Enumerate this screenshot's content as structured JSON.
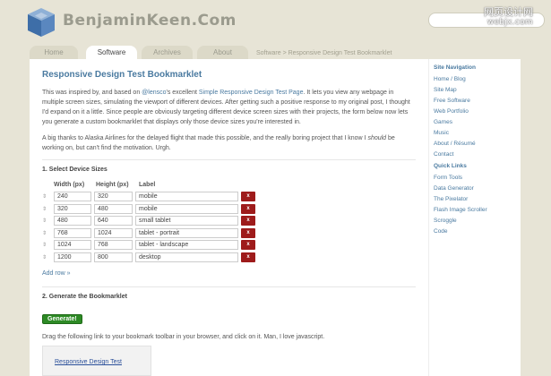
{
  "site": {
    "name": "BenjaminKeen.Com"
  },
  "watermark": {
    "line1": "网页设计网",
    "line2": "webjx.com"
  },
  "search": {
    "placeholder": ""
  },
  "nav": {
    "tabs": [
      {
        "label": "Home"
      },
      {
        "label": "Software",
        "active": true
      },
      {
        "label": "Archives"
      },
      {
        "label": "About"
      }
    ],
    "breadcrumb": "Software > Responsive Design Test Bookmarklet"
  },
  "main": {
    "title": "Responsive Design Test Bookmarklet",
    "intro": {
      "p1_a": "This was inspired by, and based on ",
      "p1_link1": "@lensco",
      "p1_b": "'s excellent ",
      "p1_link2": "Simple Responsive Design Test Page",
      "p1_c": ". It lets you view any webpage in multiple screen sizes, simulating the viewport of different devices. After getting such a positive response to my original post, I thought I'd expand on it a little. Since people are obviously targeting different device screen sizes with their projects, the form below now lets you generate a custom bookmarklet that displays only those device sizes you're interested in.",
      "p2_a": "A big thanks to Alaska Airlines for the delayed flight that made this possible, and the really boring project that I know I ",
      "p2_em": "should",
      "p2_b": " be working on, but can't find the motivation. Urgh."
    },
    "section1": {
      "title": "1. Select Device Sizes",
      "columns": [
        "Width (px)",
        "Height (px)",
        "Label"
      ],
      "rows": [
        {
          "width": "240",
          "height": "320",
          "label": "mobile"
        },
        {
          "width": "320",
          "height": "480",
          "label": "mobile"
        },
        {
          "width": "480",
          "height": "640",
          "label": "small tablet"
        },
        {
          "width": "768",
          "height": "1024",
          "label": "tablet - portrait"
        },
        {
          "width": "1024",
          "height": "768",
          "label": "tablet - landscape"
        },
        {
          "width": "1200",
          "height": "800",
          "label": "desktop"
        }
      ],
      "delete_label": "x",
      "add_row": "Add row »"
    },
    "section2": {
      "title": "2. Generate the Bookmarklet",
      "button": "Generate!",
      "instructions": "Drag the following link to your bookmark toolbar in your browser, and click on it. Man, I love javascript.",
      "bookmark_link": "Responsive Design Test"
    }
  },
  "sidebar": {
    "nav_title": "Site Navigation",
    "nav_items": [
      "Home / Blog",
      "Site Map",
      "Free Software",
      "Web Portfolio",
      "Games",
      "Music",
      "About / Résumé",
      "Contact"
    ],
    "links_title": "Quick Links",
    "links_items": [
      "Form Tools",
      "Data Generator",
      "The Pixelator",
      "Flash Image Scroller",
      "Scroggle",
      "Code"
    ]
  },
  "colors": {
    "accent": "#4a7aa0",
    "delete": "#9e1b1b",
    "generate": "#2d8a25",
    "background": "#e7e4d6"
  }
}
